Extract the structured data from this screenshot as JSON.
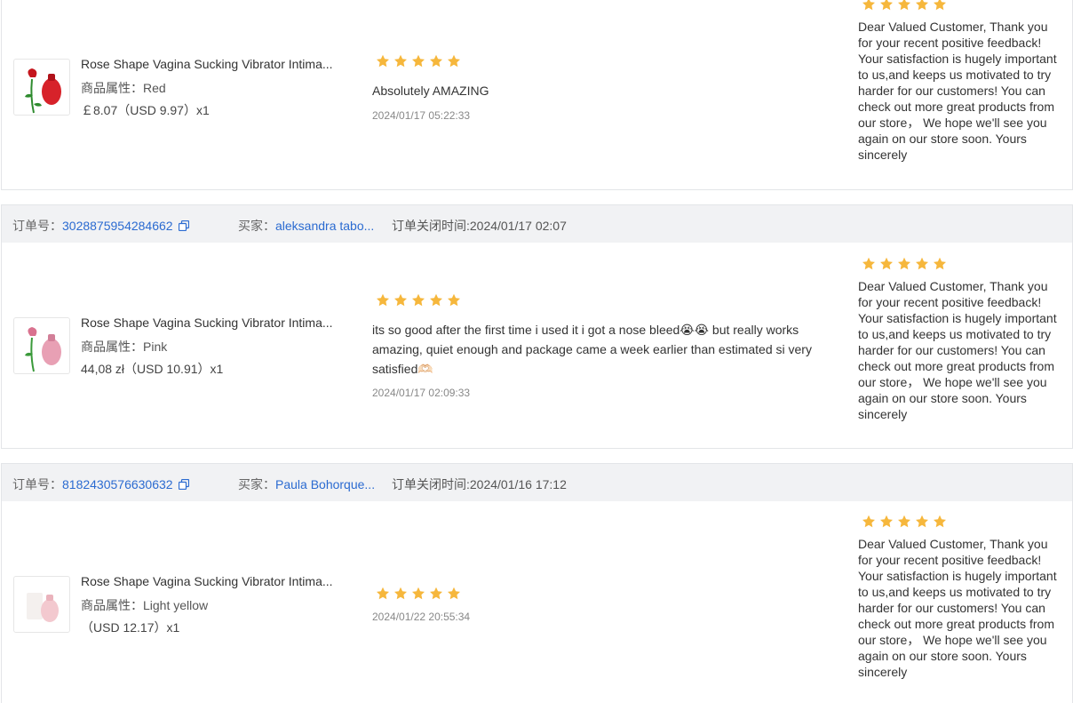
{
  "orders": [
    {
      "product": {
        "title": "Rose Shape Vagina Sucking Vibrator Intima...",
        "attr_label": "商品属性：",
        "attr_value": "Red",
        "price": "￡8.07（USD  9.97）x1",
        "thumb_color": "#d7222a"
      },
      "review": {
        "rating": 5,
        "text": "Absolutely AMAZING",
        "date": "2024/01/17 05:22:33"
      },
      "reply": {
        "rating": 5,
        "text": "Dear Valued Customer, Thank you for your recent positive feedback! Your satisfaction is hugely important to us,and keeps us motivated to try harder for our customers! You can check out more great products from our store，  We hope we'll see you again on our store soon. Yours sincerely"
      }
    },
    {
      "header": {
        "order_label": "订单号：",
        "order_no": "3028875954284662",
        "buyer_label": "买家：",
        "buyer": "aleksandra tabo...",
        "close_label": "订单关闭时间:",
        "close_time": "2024/01/17 02:07"
      },
      "product": {
        "title": "Rose Shape Vagina Sucking Vibrator Intima...",
        "attr_label": "商品属性：",
        "attr_value": "Pink",
        "price": "44,08 zł（USD  10.91）x1",
        "thumb_color": "#e8a0b4"
      },
      "review": {
        "rating": 5,
        "text": "its so good after the first time i used it i got a nose bleed😭😭 but really works amazing, quiet enough and package came a week earlier than estimated si very satisfied🫶🏻",
        "date": "2024/01/17 02:09:33"
      },
      "reply": {
        "rating": 5,
        "text": "Dear Valued Customer, Thank you for your recent positive feedback! Your satisfaction is hugely important to us,and keeps us motivated to try harder for our customers! You can check out more great products from our store，  We hope we'll see you again on our store soon. Yours sincerely"
      }
    },
    {
      "header": {
        "order_label": "订单号：",
        "order_no": "8182430576630632",
        "buyer_label": "买家：",
        "buyer": "Paula Bohorque...",
        "close_label": "订单关闭时间:",
        "close_time": "2024/01/16 17:12"
      },
      "product": {
        "title": "Rose Shape Vagina Sucking Vibrator Intima...",
        "attr_label": "商品属性：",
        "attr_value": "Light yellow",
        "price": "（USD  12.17）x1",
        "thumb_color": "#f3c9cf"
      },
      "review": {
        "rating": 5,
        "text": "",
        "date": "2024/01/22 20:55:34"
      },
      "reply": {
        "rating": 5,
        "text": "Dear Valued Customer, Thank you for your recent positive feedback! Your satisfaction is hugely important to us,and keeps us motivated to try harder for our customers! You can check out more great products from our store，  We hope we'll see you again on our store soon. Yours sincerely"
      }
    }
  ],
  "colors": {
    "star": "#f6b73c",
    "link": "#2b6bd1",
    "header_bg": "#f1f2f4"
  },
  "icons": {
    "copy": "copy-icon",
    "star": "star-icon"
  }
}
